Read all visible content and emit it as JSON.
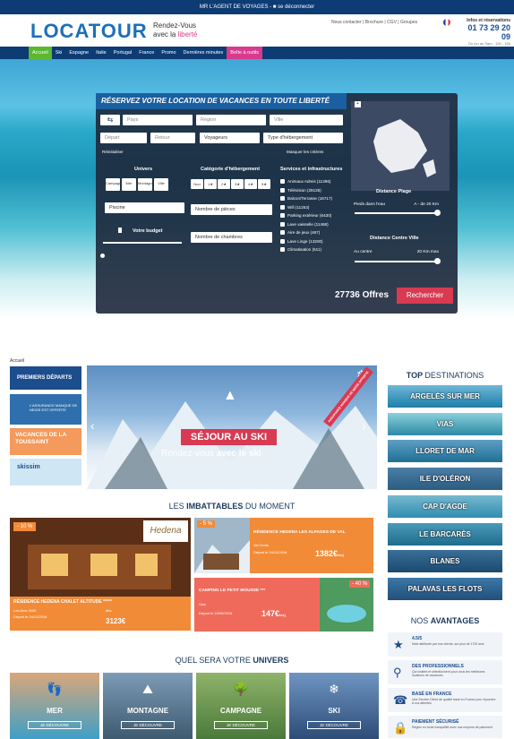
{
  "topbar": {
    "text": "MR L'AGENT DE VOYAGES - ■ se déconnecter"
  },
  "header": {
    "logo": "LOCATOUR",
    "tagline_l1": "Rendez-Vous",
    "tagline_l2a": "avec la ",
    "tagline_l2b": "liberté",
    "links": "Nous contacter | Brochure | CGV | Groupes",
    "phone_title": "Infos et réservations",
    "phone": "01 73 29 20 09",
    "phone_hours": "Du lun au Sam - 10h - 18h"
  },
  "nav": {
    "items": [
      "Accueil",
      "Ski",
      "Espagne",
      "Italie",
      "Portugal",
      "France",
      "Promo",
      "Dernières minutes",
      "Boîte à outils"
    ]
  },
  "search": {
    "title": "RÉSERVEZ VOTRE LOCATION DE VACANCES EN TOUTE LIBERTÉ",
    "pays": "Pays",
    "region": "Region",
    "ville": "Ville",
    "depart": "Départ",
    "retour": "Retour",
    "voyageurs": "Voyageurs",
    "type": "Type d'hébergement",
    "reinit": "Réinitialiser",
    "masquer": "Masquer les critères",
    "univers": "Univers",
    "univers_items": [
      "Campagne",
      "Mer",
      "Montagne",
      "Ville"
    ],
    "categorie": "Catégorie d'hébergement",
    "cat_items": [
      "Non classé",
      "1★",
      "2★",
      "3★",
      "4★",
      "5★"
    ],
    "services": "Services et infrastructures",
    "services_items": [
      "Animaux Admis (11396)",
      "Télévision (29136)",
      "Balcon/Terrasse (16717)",
      "Wifi (11253)",
      "Parking extérieur (6430)",
      "Lave vaisselle (11468)",
      "Aire de jeux (467)",
      "Lave Linge (13200)",
      "Climatisation (511)"
    ],
    "piscine": "Piscine",
    "pieces": "Nombre de pièces",
    "chambres": "Nombre de chambres",
    "budget": "Votre budget",
    "distance_plage": "Distance Plage",
    "plage_left": "Pieds dans l'eau",
    "plage_right": "A - de 20 Km",
    "distance_ville": "Distance Centre Ville",
    "ville_left": "Au centre",
    "ville_right": "20 Km max",
    "offers": "27736 Offres",
    "button": "Rechercher"
  },
  "breadcrumb": "Accueil",
  "left": {
    "premiers": "PREMIERS DÉPARTS",
    "assurance": "L'ASSURANCE MANQUE DE NEIGE EST OFFERTE",
    "toussaint": "VACANCES DE LA TOUSSAINT",
    "skiss": "skissim"
  },
  "slider": {
    "title": "SÉJOUR AU SKI",
    "sub_a": "Rendez-vous ",
    "sub_b": "avec le ski",
    "ribbon": "ASSURANCE MANQUE DE NEIGE OFFERTE"
  },
  "imbattables": {
    "title_a": "LES ",
    "title_b": "IMBATTABLES",
    "title_c": " DU MOMENT",
    "big": {
      "discount": "- 10 %",
      "name": "RÉSIDENCE HEDENA CHALET ALTITUDE *****",
      "place": "Les Arcs 2000",
      "date": "Départ le 04/12/2016",
      "price_lbl": "dès",
      "price": "3123€",
      "logo": "Hedena"
    },
    "c2": {
      "discount": "- 5 %",
      "name": "RÉSIDENCE HEDENA LES ALPAGES DE VAL",
      "place": "Val Cenis",
      "date": "Départ le 24/12/2016",
      "price": "1382€",
      "unit": "/sej"
    },
    "c3": {
      "discount": "- 40 %",
      "name": "CAMPING LE PETIT MOUSSE ***",
      "place": "Vias",
      "date": "Départ le 24/09/2016",
      "price": "147€",
      "unit": "/sej"
    }
  },
  "destinations": {
    "title_a": "TOP ",
    "title_b": "DESTINATIONS",
    "items": [
      "ARGELÈS SUR MER",
      "VIAS",
      "LLORET DE MAR",
      "ILE D'OLÉRON",
      "CAP D'AGDE",
      "LE BARCARÈS",
      "BLANES",
      "PALAVAS LES FLOTS"
    ]
  },
  "avantages": {
    "title_a": "NOS ",
    "title_b": "AVANTAGES",
    "items": [
      {
        "t": "4.5/5",
        "d": "Note attribuée par nos clients, sur plus de 1700 avis"
      },
      {
        "t": "DES PROFESSIONNELS",
        "d": "Qui visitent et sélectionnent pour vous les meilleures locations de vacances"
      },
      {
        "t": "BASÉ EN FRANCE",
        "d": "Une Service Client de qualité basé en France pour répondre à vos attentes"
      },
      {
        "t": "PAIEMENT SÉCURISÉ",
        "d": "Réglez en toute tranquillité avec nos moyens de paiement"
      }
    ]
  },
  "univers": {
    "title_a": "QUEL SERA VOTRE ",
    "title_b": "UNIVERS",
    "items": [
      {
        "n": "MER",
        "b": "JE DÉCOUVRE"
      },
      {
        "n": "MONTAGNE",
        "b": "JE DÉCOUVRE"
      },
      {
        "n": "CAMPAGNE",
        "b": "JE DÉCOUVRE"
      },
      {
        "n": "SKI",
        "b": "JE DÉCOUVRE"
      }
    ]
  }
}
